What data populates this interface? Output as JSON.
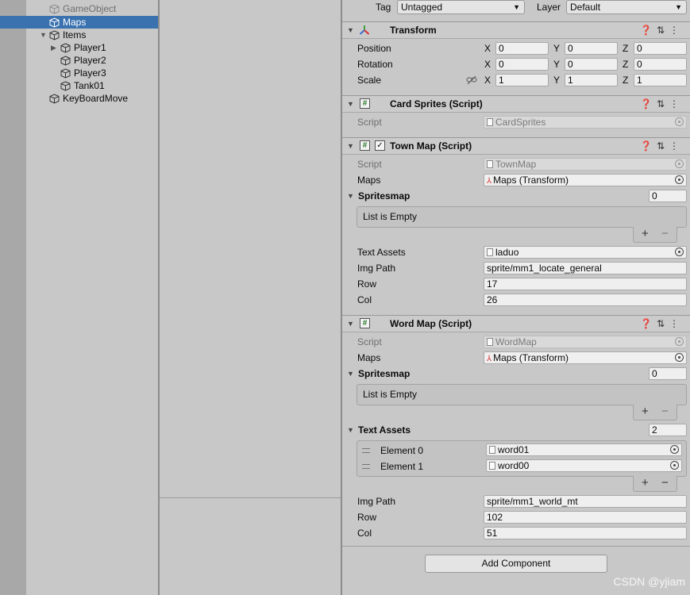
{
  "hierarchy": {
    "items": [
      {
        "label": "GameObject",
        "state": "disabled"
      },
      {
        "label": "Maps",
        "state": "selected"
      },
      {
        "label": "Items",
        "state": "normal"
      },
      {
        "label": "Player1",
        "state": "normal"
      },
      {
        "label": "Player2",
        "state": "normal"
      },
      {
        "label": "Player3",
        "state": "normal"
      },
      {
        "label": "Tank01",
        "state": "normal"
      },
      {
        "label": "KeyBoardMove",
        "state": "normal"
      }
    ]
  },
  "inspector": {
    "tag_label": "Tag",
    "tag_value": "Untagged",
    "layer_label": "Layer",
    "layer_value": "Default",
    "transform": {
      "title": "Transform",
      "position_label": "Position",
      "rotation_label": "Rotation",
      "scale_label": "Scale",
      "axis_x": "X",
      "axis_y": "Y",
      "axis_z": "Z",
      "position": [
        "0",
        "0",
        "0"
      ],
      "rotation": [
        "0",
        "0",
        "0"
      ],
      "scale": [
        "1",
        "1",
        "1"
      ]
    },
    "card_sprites": {
      "title": "Card Sprites (Script)",
      "script_label": "Script",
      "script_value": "CardSprites"
    },
    "town_map": {
      "title": "Town Map (Script)",
      "script_label": "Script",
      "script_value": "TownMap",
      "maps_label": "Maps",
      "maps_value": "Maps (Transform)",
      "spritesmap_label": "Spritesmap",
      "spritesmap_count": "0",
      "empty_text": "List is Empty",
      "text_assets_label": "Text Assets",
      "text_assets_value": "laduo",
      "img_path_label": "Img Path",
      "img_path_value": "sprite/mm1_locate_general",
      "row_label": "Row",
      "row_value": "17",
      "col_label": "Col",
      "col_value": "26"
    },
    "word_map": {
      "title": "Word Map (Script)",
      "script_label": "Script",
      "script_value": "WordMap",
      "maps_label": "Maps",
      "maps_value": "Maps (Transform)",
      "spritesmap_label": "Spritesmap",
      "spritesmap_count": "0",
      "empty_text": "List is Empty",
      "text_assets_label": "Text Assets",
      "text_assets_count": "2",
      "elements": [
        {
          "label": "Element 0",
          "value": "word01"
        },
        {
          "label": "Element 1",
          "value": "word00"
        }
      ],
      "img_path_label": "Img Path",
      "img_path_value": "sprite/mm1_world_mt",
      "row_label": "Row",
      "row_value": "102",
      "col_label": "Col",
      "col_value": "51"
    },
    "list_add": "+",
    "list_remove": "−",
    "add_component_label": "Add Component"
  },
  "watermark": "CSDN @yjiam",
  "colors": {
    "selection": "#3a72b0",
    "panel_bg": "#c8c8c8",
    "script_icon": "#2a7a2a"
  },
  "icons": {
    "transform": "transform-axes-icon",
    "script": "csharp-script-icon",
    "help": "help-icon",
    "presets": "presets-icon",
    "menu": "kebab-menu-icon",
    "gameobject": "cube-icon"
  }
}
